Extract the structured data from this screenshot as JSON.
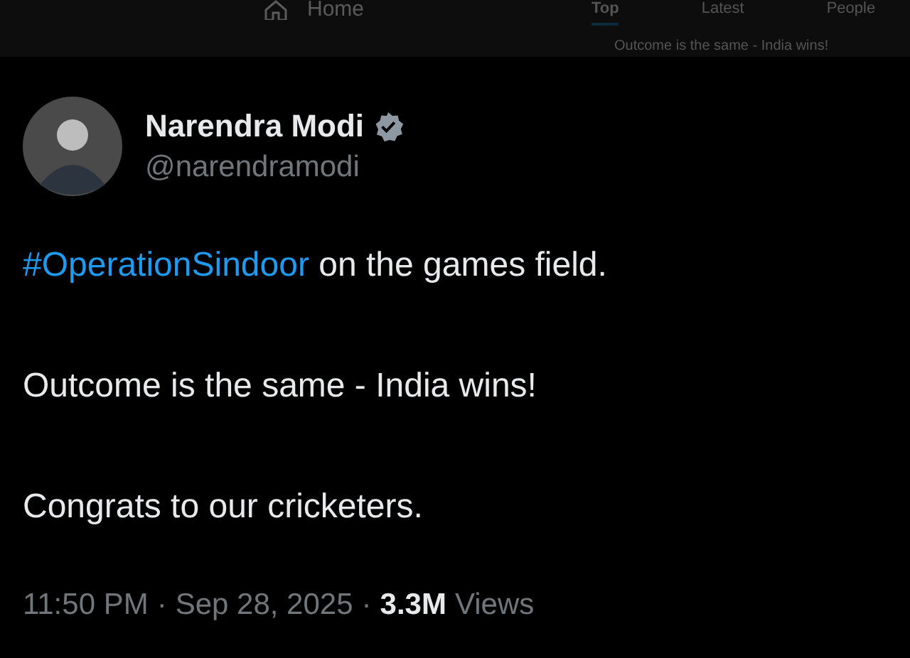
{
  "top_bar": {
    "home_label": "Home",
    "tabs": [
      {
        "label": "Top",
        "selected": true
      },
      {
        "label": "Latest",
        "selected": false
      },
      {
        "label": "People",
        "selected": false
      }
    ],
    "peek_text": "Outcome is the same - India wins!"
  },
  "tweet": {
    "author": {
      "name": "Narendra Modi",
      "verified": true,
      "handle": "@narendramodi"
    },
    "paragraphs": [
      [
        {
          "text": "#OperationSindoor",
          "kind": "hashtag"
        },
        {
          "text": " on the games field.",
          "kind": "plain"
        }
      ],
      [
        {
          "text": "Outcome is the same - India wins!",
          "kind": "plain"
        }
      ],
      [
        {
          "text": "Congrats to our cricketers.",
          "kind": "plain"
        }
      ]
    ],
    "time": "11:50 PM",
    "separator": "·",
    "date": "Sep 28, 2025",
    "views_count": "3.3M",
    "views_label": "Views"
  }
}
